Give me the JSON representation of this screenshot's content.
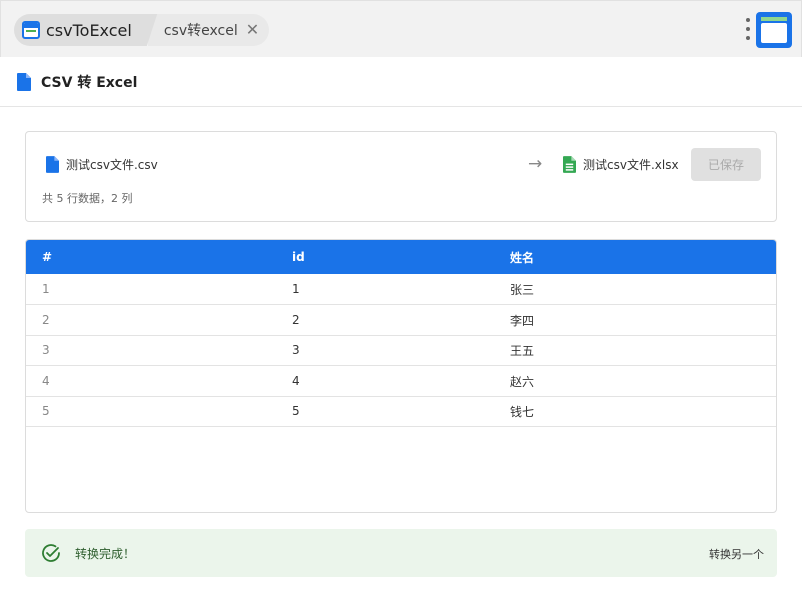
{
  "tabs": {
    "main_label": "csvToExcel",
    "sub_label": "csv转excel",
    "close_glyph": "✕"
  },
  "header": {
    "title": "CSV 转 Excel",
    "icon": "file-icon",
    "icon_color": "#1a73e8"
  },
  "file_card": {
    "source_name": "测试csv文件.csv",
    "source_icon": "csv-file-icon",
    "row_info": "共 5 行数据，2 列",
    "arrow": "→",
    "target_name": "测试csv文件.xlsx",
    "target_icon": "xlsx-file-icon",
    "target_icon_color": "#34a853",
    "save_label": "已保存"
  },
  "table": {
    "header_color": "#1a73e8",
    "columns": [
      "#",
      "id",
      "姓名"
    ],
    "rows": [
      [
        "1",
        "1",
        "张三"
      ],
      [
        "2",
        "2",
        "李四"
      ],
      [
        "3",
        "3",
        "王五"
      ],
      [
        "4",
        "4",
        "赵六"
      ],
      [
        "5",
        "5",
        "钱七"
      ]
    ]
  },
  "status": {
    "text": "转换完成！",
    "again_label": "转换另一个",
    "background": "#ebf5eb",
    "icon": "check-circle-icon"
  }
}
